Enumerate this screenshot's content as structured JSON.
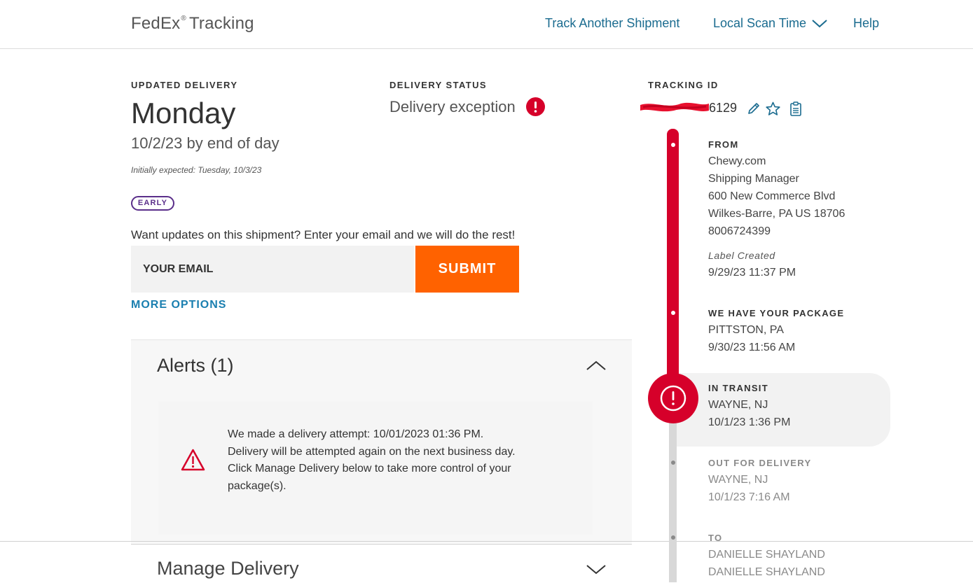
{
  "header": {
    "brand": "FedEx",
    "brand_mark": "®",
    "brand_suffix": "Tracking",
    "nav": {
      "track_another": "Track Another Shipment",
      "local_scan_time": "Local Scan Time",
      "help": "Help"
    }
  },
  "delivery": {
    "label": "UPDATED DELIVERY",
    "day": "Monday",
    "date_line": "10/2/23 by end of day",
    "initially_expected": "Initially expected: Tuesday, 10/3/23",
    "badge": "EARLY"
  },
  "status": {
    "label": "DELIVERY STATUS",
    "value": "Delivery exception"
  },
  "email_updates": {
    "prompt": "Want updates on this shipment? Enter your email and we will do the rest!",
    "placeholder": "YOUR EMAIL",
    "submit_label": "SUBMIT",
    "more_options": "MORE OPTIONS"
  },
  "alerts": {
    "title": "Alerts (1)",
    "lines": [
      "We made a delivery attempt: 10/01/2023 01:36 PM.",
      "Delivery will be attempted again on the next business day.",
      "Click Manage Delivery below to take more control of your",
      "package(s)."
    ]
  },
  "manage_delivery": {
    "title": "Manage Delivery"
  },
  "tracking": {
    "label": "TRACKING ID",
    "id_visible": "6129"
  },
  "timeline": {
    "from": {
      "label": "FROM",
      "lines": [
        "Chewy.com",
        "Shipping Manager",
        "600 New Commerce Blvd",
        "Wilkes-Barre, PA US 18706",
        "8006724399"
      ],
      "sub_label": "Label Created",
      "sub_value": "9/29/23 11:37 PM"
    },
    "have_package": {
      "label": "WE HAVE YOUR PACKAGE",
      "location": "PITTSTON, PA",
      "time": "9/30/23 11:56 AM"
    },
    "in_transit": {
      "label": "IN TRANSIT",
      "location": "WAYNE, NJ",
      "time": "10/1/23 1:36 PM"
    },
    "out_for_delivery": {
      "label": "OUT FOR DELIVERY",
      "location": "WAYNE, NJ",
      "time": "10/1/23 7:16 AM"
    },
    "to": {
      "label": "TO",
      "lines": [
        "DANIELLE SHAYLAND",
        "DANIELLE SHAYLAND"
      ]
    }
  },
  "colors": {
    "fedex_red": "#d6002a",
    "link_teal": "#1a6b8f",
    "submit_orange": "#ff6200",
    "badge_purple": "#5a2e8a"
  },
  "icons": [
    "chevron-down-icon",
    "exclamation-circle-icon",
    "pencil-icon",
    "star-icon",
    "clipboard-icon",
    "chevron-up-icon",
    "warning-triangle-icon"
  ]
}
